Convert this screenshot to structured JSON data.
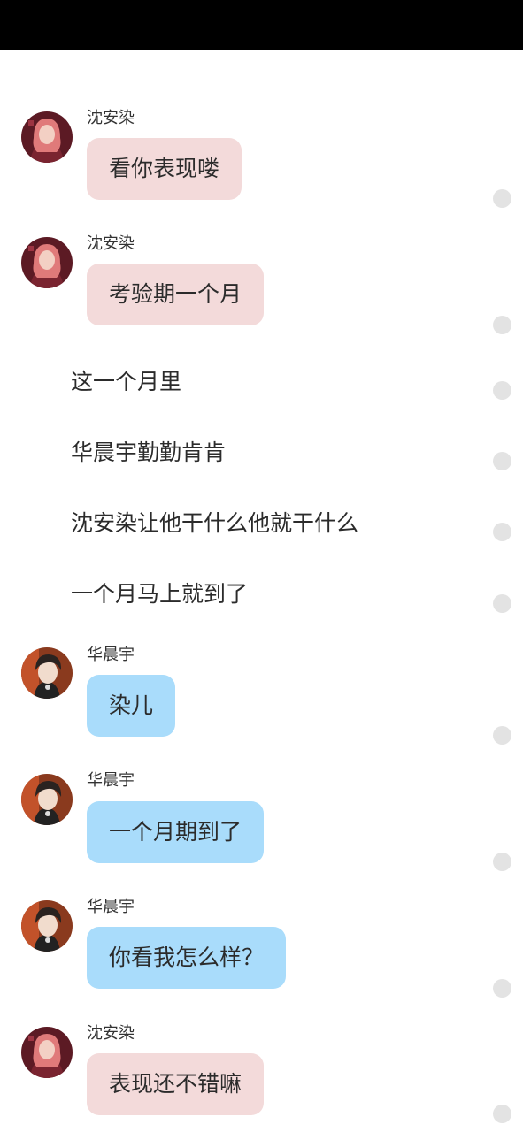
{
  "colors": {
    "status_bar": "#000000",
    "bubble_pink": "#f3dada",
    "bubble_blue": "#a9dcfb",
    "dot": "#e3e3e3"
  },
  "messages": [
    {
      "kind": "bubble",
      "sender": "沈安染",
      "text": "看你表现喽",
      "avatar": "avatar-shen-anran",
      "bubble_color": "pink"
    },
    {
      "kind": "bubble",
      "sender": "沈安染",
      "text": "考验期一个月",
      "avatar": "avatar-shen-anran",
      "bubble_color": "pink"
    },
    {
      "kind": "narration",
      "text": "这一个月里"
    },
    {
      "kind": "narration",
      "text": "华晨宇勤勤肯肯"
    },
    {
      "kind": "narration",
      "text": "沈安染让他干什么他就干什么"
    },
    {
      "kind": "narration",
      "text": "一个月马上就到了"
    },
    {
      "kind": "bubble",
      "sender": "华晨宇",
      "text": "染儿",
      "avatar": "avatar-hua-chenyu",
      "bubble_color": "blue"
    },
    {
      "kind": "bubble",
      "sender": "华晨宇",
      "text": "一个月期到了",
      "avatar": "avatar-hua-chenyu",
      "bubble_color": "blue"
    },
    {
      "kind": "bubble",
      "sender": "华晨宇",
      "text": "你看我怎么样？",
      "avatar": "avatar-hua-chenyu",
      "bubble_color": "blue"
    },
    {
      "kind": "bubble",
      "sender": "沈安染",
      "text": "表现还不错嘛",
      "avatar": "avatar-shen-anran",
      "bubble_color": "pink"
    }
  ]
}
